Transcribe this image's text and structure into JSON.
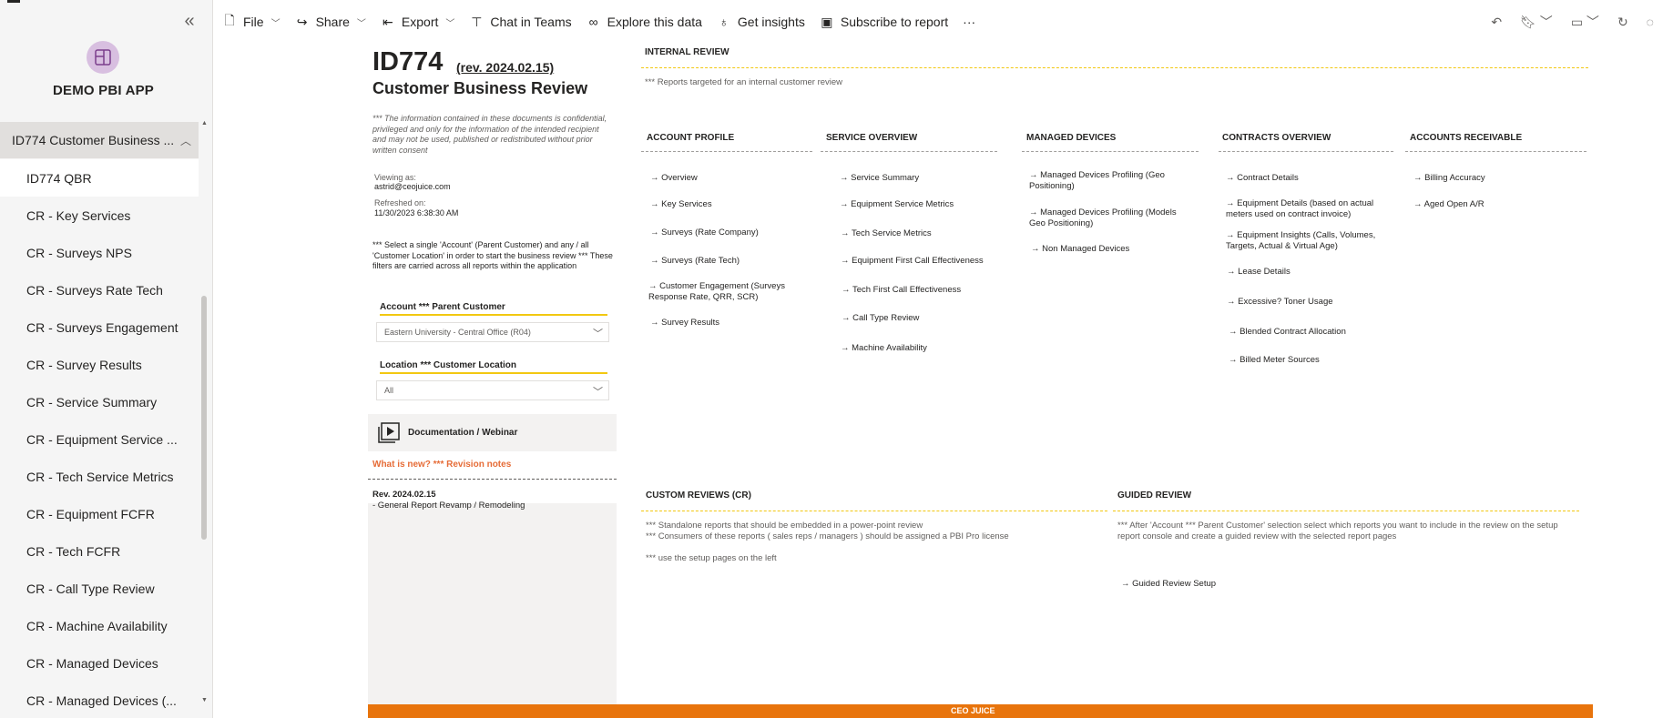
{
  "sidebar": {
    "app_name": "DEMO PBI APP",
    "section_label": "ID774 Customer Business ...",
    "items": [
      {
        "label": "ID774 QBR",
        "active": true
      },
      {
        "label": "CR - Key Services"
      },
      {
        "label": "CR - Surveys NPS"
      },
      {
        "label": "CR - Surveys Rate Tech"
      },
      {
        "label": "CR - Surveys Engagement"
      },
      {
        "label": "CR - Survey Results"
      },
      {
        "label": "CR - Service Summary"
      },
      {
        "label": "CR - Equipment Service ..."
      },
      {
        "label": "CR - Tech Service Metrics"
      },
      {
        "label": "CR - Equipment FCFR"
      },
      {
        "label": "CR - Tech FCFR"
      },
      {
        "label": "CR - Call Type Review"
      },
      {
        "label": "CR - Machine Availability"
      },
      {
        "label": "CR - Managed Devices"
      },
      {
        "label": "CR - Managed Devices (..."
      }
    ]
  },
  "toolbar": {
    "file": "File",
    "share": "Share",
    "export": "Export",
    "chat": "Chat in Teams",
    "explore": "Explore this data",
    "insights": "Get insights",
    "subscribe": "Subscribe to report",
    "more": "···"
  },
  "report": {
    "id": "ID774",
    "rev": "(rev. 2024.02.15)",
    "subtitle": "Customer Business Review",
    "confidential": "*** The information contained in these documents is confidential, privileged and only for the information of the intended recipient and may not be used, published or redistributed without prior written consent",
    "viewing_as_label": "Viewing as:",
    "viewing_as": "astrid@ceojuice.com",
    "refreshed_label": "Refreshed on:",
    "refreshed": "11/30/2023 6:38:30 AM",
    "select_note": "*** Select a single 'Account' (Parent Customer) and any / all 'Customer Location' in order to start the business review *** These filters are carried across all reports within the application",
    "account_filter_title": "Account *** Parent Customer",
    "account_filter_value": "Eastern University - Central Office (R04)",
    "location_filter_title": "Location *** Customer Location",
    "location_filter_value": "All",
    "doc_label": "Documentation / Webinar",
    "whats_new": "What is new? *** Revision notes",
    "rev_title": "Rev. 2024.02.15",
    "rev_note": "- General Report Revamp / Remodeling",
    "internal_review": "INTERNAL REVIEW",
    "internal_note": "*** Reports targeted for an internal customer review",
    "account_profile": {
      "title": "ACCOUNT PROFILE",
      "links": [
        "→ Overview",
        "→ Key Services",
        "→ Surveys (Rate Company)",
        "→ Surveys (Rate Tech)",
        "→ Customer Engagement (Surveys Response Rate, QRR, SCR)",
        "→ Survey Results"
      ]
    },
    "service_overview": {
      "title": "SERVICE OVERVIEW",
      "links": [
        "→ Service Summary",
        "→ Equipment Service Metrics",
        "→ Tech Service Metrics",
        "→ Equipment First Call Effectiveness",
        "→ Tech First Call Effectiveness",
        "→ Call Type Review",
        "→ Machine Availability"
      ]
    },
    "managed_devices": {
      "title": "MANAGED DEVICES",
      "links": [
        "→ Managed Devices Profiling (Geo Positioning)",
        "→ Managed Devices Profiling (Models Geo Positioning)",
        "→ Non Managed Devices"
      ]
    },
    "contracts_overview": {
      "title": "CONTRACTS OVERVIEW",
      "links": [
        "→ Contract Details",
        "→ Equipment Details (based on actual meters used on contract invoice)",
        "→ Equipment Insights (Calls, Volumes, Targets, Actual & Virtual Age)",
        "→ Lease Details",
        "→ Excessive? Toner Usage",
        "→ Blended Contract Allocation",
        "→ Billed Meter Sources"
      ]
    },
    "accounts_receivable": {
      "title": "ACCOUNTS RECEIVABLE",
      "links": [
        "→ Billing Accuracy",
        "→ Aged Open A/R"
      ]
    },
    "custom_reviews": {
      "title": "CUSTOM REVIEWS (CR)",
      "note1": "*** Standalone reports that should be embedded in a power-point review",
      "note2": "*** Consumers of these reports ( sales reps / managers ) should be assigned a PBI Pro license",
      "note3": "*** use the setup pages on the left"
    },
    "guided_review": {
      "title": "GUIDED REVIEW",
      "note": "*** After 'Account *** Parent Customer' selection select which reports you want to include in the review on the setup report console and create a guided review with the selected report pages",
      "link": "→ Guided Review Setup"
    },
    "footer_logo": "CEO JUICE"
  },
  "colors": {
    "accent": "#f2c811",
    "orange": "#e8740c",
    "sidebar_bg": "#f5f5f5",
    "app_icon": "#d8bfe0"
  }
}
